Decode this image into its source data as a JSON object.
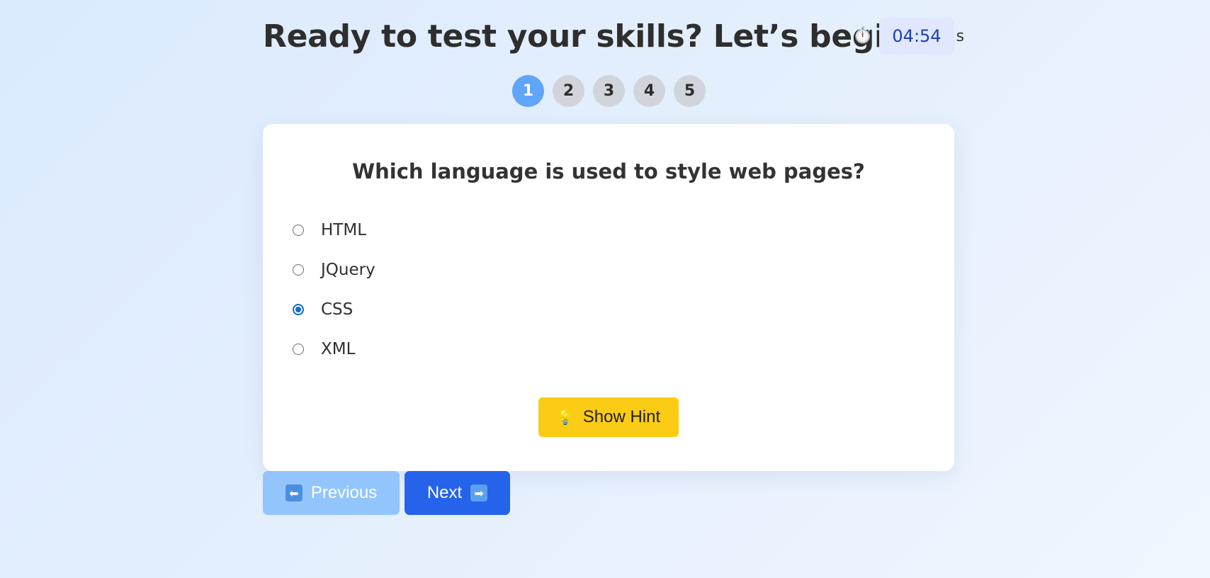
{
  "header": {
    "title": "Ready to test your skills? Let’s begin!",
    "stopwatch_icon": "⏱️",
    "timer_value": "04:54",
    "timer_unit": "s"
  },
  "steps": [
    {
      "label": "1",
      "active": true
    },
    {
      "label": "2",
      "active": false
    },
    {
      "label": "3",
      "active": false
    },
    {
      "label": "4",
      "active": false
    },
    {
      "label": "5",
      "active": false
    }
  ],
  "question": {
    "text": "Which language is used to style web pages?",
    "options": [
      {
        "label": "HTML",
        "selected": false
      },
      {
        "label": "JQuery",
        "selected": false
      },
      {
        "label": "CSS",
        "selected": true
      },
      {
        "label": "XML",
        "selected": false
      }
    ]
  },
  "hint_button": {
    "icon": "💡",
    "label": "Show Hint"
  },
  "navigation": {
    "previous_icon": "⬅",
    "previous_label": "Previous",
    "next_label": "Next",
    "next_icon": "➡"
  },
  "colors": {
    "active_step": "#60a5fa",
    "hint_button": "#facc15",
    "next_button": "#2563eb",
    "previous_button": "#93c5fd",
    "timer_bg": "#e0e7ff"
  }
}
